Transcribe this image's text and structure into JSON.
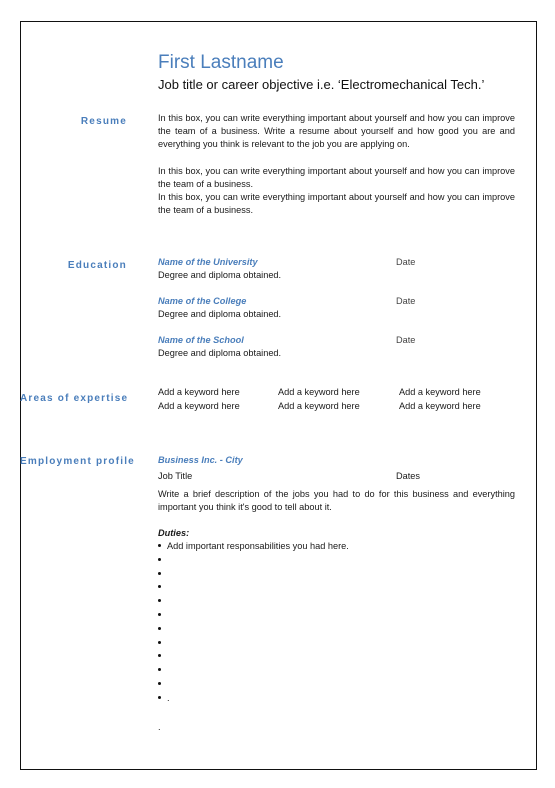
{
  "header": {
    "name": "First Lastname",
    "objective": "Job title or career objective  i.e. ‘Electromechanical Tech.’"
  },
  "resume": {
    "label": "Resume",
    "paragraph1": "In this box, you can write everything important about yourself and how you can improve the team of a business.  Write a resume about yourself and how good you are and everything  you think is relevant to the job you are applying on.",
    "paragraph2_line1": "In this box, you can write everything important about yourself and how you can improve the team of a business.",
    "paragraph2_line2": "In this box, you can write everything important about yourself and how you can improve the team of a business."
  },
  "education": {
    "label": "Education",
    "entries": [
      {
        "institution": "Name of the University",
        "date": "Date",
        "degree": "Degree and diploma obtained."
      },
      {
        "institution": "Name of the College",
        "date": "Date",
        "degree": "Degree and diploma obtained."
      },
      {
        "institution": "Name of the School",
        "date": "Date",
        "degree": "Degree and diploma obtained."
      }
    ]
  },
  "expertise": {
    "label": "Areas of expertise",
    "keywords": [
      [
        "Add a keyword  here",
        "Add a keyword  here",
        "Add a keyword  here"
      ],
      [
        "Add a keyword  here",
        "Add a keyword  here",
        "Add a keyword  here"
      ]
    ]
  },
  "employment": {
    "label": "Employment profile",
    "company": "Business Inc. - City",
    "job_title": "Job Title",
    "dates": "Dates",
    "description": "Write a brief description of the jobs you had to do for this business and everything important you think it's good to tell about it.",
    "duties_label": "Duties:",
    "duties": [
      "Add important responsabilities  you had here.",
      "",
      "",
      "",
      "",
      "",
      "",
      "",
      "",
      "",
      "",
      "."
    ],
    "trailing": "."
  }
}
